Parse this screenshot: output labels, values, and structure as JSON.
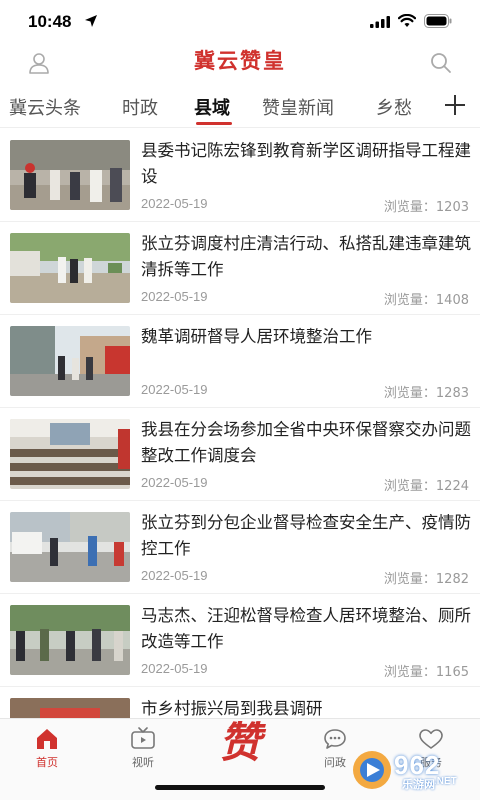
{
  "status_bar": {
    "time": "10:48"
  },
  "header": {
    "title": "冀云赞皇"
  },
  "tabs": [
    {
      "label": "冀云头条"
    },
    {
      "label": "时政"
    },
    {
      "label": "县域"
    },
    {
      "label": "赞皇新闻"
    },
    {
      "label": "乡愁"
    }
  ],
  "active_tab": "县域",
  "news": [
    {
      "title": "县委书记陈宏锋到教育新学区调研指导工程建设",
      "date": "2022-05-19",
      "views": "浏览量：1203"
    },
    {
      "title": "张立芬调度村庄清洁行动、私搭乱建违章建筑清拆等工作",
      "date": "2022-05-19",
      "views": "浏览量：1408"
    },
    {
      "title": "魏革调研督导人居环境整治工作",
      "date": "2022-05-19",
      "views": "浏览量：1283"
    },
    {
      "title": "我县在分会场参加全省中央环保督察交办问题整改工作调度会",
      "date": "2022-05-19",
      "views": "浏览量：1224"
    },
    {
      "title": "张立芬到分包企业督导检查安全生产、疫情防控工作",
      "date": "2022-05-19",
      "views": "浏览量：1282"
    },
    {
      "title": "马志杰、汪迎松督导检查人居环境整治、厕所改造等工作",
      "date": "2022-05-19",
      "views": "浏览量：1165"
    },
    {
      "title": "市乡村振兴局到我县调研",
      "date": "",
      "views": ""
    }
  ],
  "bottom_nav": {
    "home": "首页",
    "video": "视听",
    "center_glyph": "赞",
    "politics": "问政",
    "service": "服务"
  },
  "watermark": {
    "brand": "962",
    "net": ".NET",
    "site": "乐游网"
  },
  "colors": {
    "accent": "#d0322e",
    "text": "#222222",
    "meta": "#9a9a9a"
  }
}
